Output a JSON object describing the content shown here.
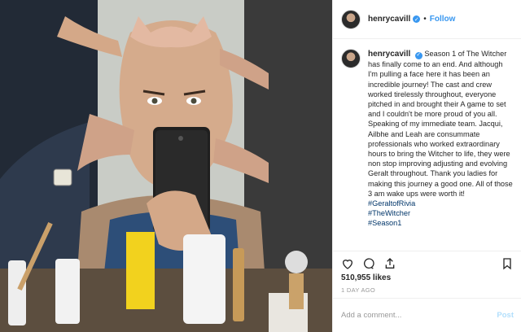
{
  "header": {
    "username": "henrycavill",
    "verified_glyph": "✓",
    "separator": "•",
    "follow_label": "Follow"
  },
  "caption": {
    "username": "henrycavill",
    "verified_glyph": "✓",
    "text_1": "Season 1 of The Witcher has finally come to an end. And although I'm pulling a face here it has been an incredible journey! The cast and crew worked tirelessly throughout, everyone pitched in and brought their A game to set and I couldn't be more proud of you all.",
    "text_2": "Speaking of my immediate team. Jacqui, Ailbhe and Leah are consummate professionals who worked extraordinary hours to bring the Witcher to life, they were non stop improving adjusting and evolving Geralt throughout. Thank you ladies for making this journey a good one. All of those 3 am wake ups were worth it!",
    "hashtags": [
      "#GeraltofRivia",
      "#TheWitcher",
      "#Season1"
    ]
  },
  "actions": {
    "icons": [
      "heart-icon",
      "comment-icon",
      "share-icon",
      "bookmark-icon"
    ]
  },
  "likes": "510,955 likes",
  "date": "1 DAY AGO",
  "comment_box": {
    "placeholder": "Add a comment...",
    "post_label": "Post"
  },
  "colors": {
    "link_blue": "#3897f0",
    "hashtag": "#003569",
    "text": "#262626",
    "muted": "#999999"
  }
}
